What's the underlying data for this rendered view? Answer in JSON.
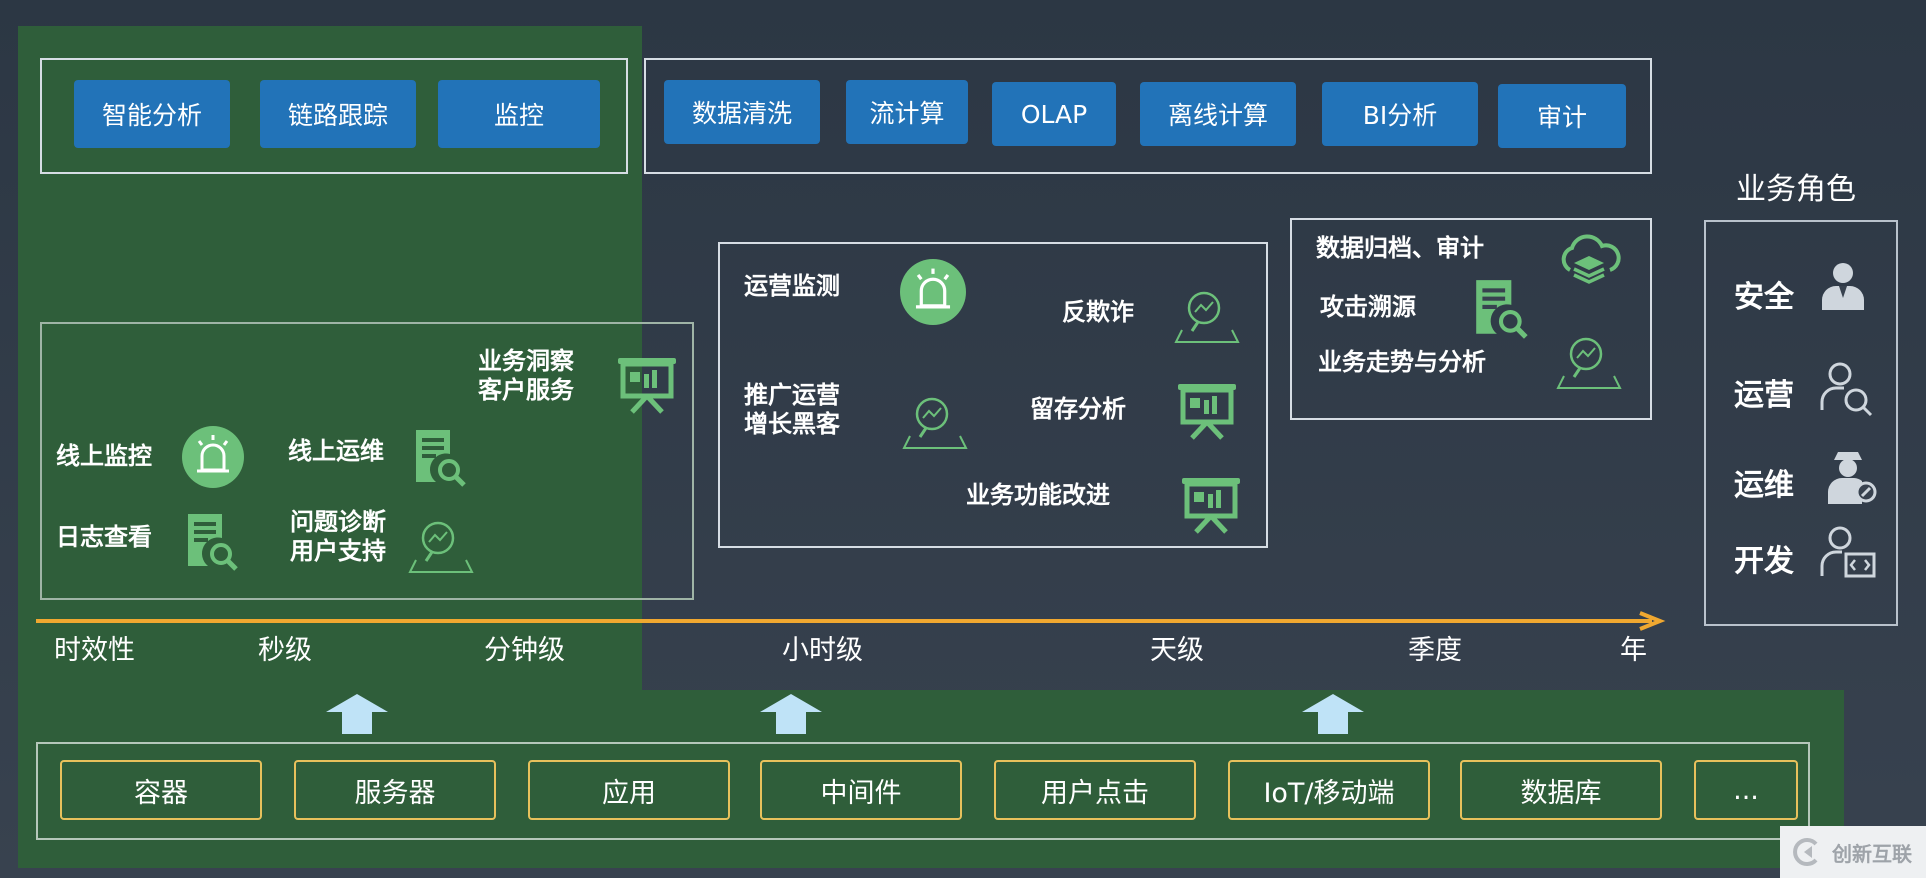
{
  "top_buttons_left": [
    "智能分析",
    "链路跟踪",
    "监控"
  ],
  "top_buttons_right": [
    "数据清洗",
    "流计算",
    "OLAP",
    "离线计算",
    "BI分析",
    "审计"
  ],
  "realtime_box": {
    "business_insight": [
      "业务洞察",
      "客户服务"
    ],
    "online_monitor": "线上监控",
    "online_ops": "线上运维",
    "log_view": "日志查看",
    "diagnosis": [
      "问题诊断",
      "用户支持"
    ]
  },
  "hourly_box": {
    "ops_monitor": "运营监测",
    "anti_fraud": "反欺诈",
    "promotion": [
      "推广运营",
      "增长黑客"
    ],
    "retention": "留存分析",
    "feature_improve": "业务功能改进"
  },
  "daily_box": {
    "archive_audit": "数据归档、审计",
    "attack_trace": "攻击溯源",
    "trend_analysis": "业务走势与分析"
  },
  "roles": {
    "title": "业务角色",
    "items": [
      "安全",
      "运营",
      "运维",
      "开发"
    ]
  },
  "timeline": {
    "ticks": [
      "时效性",
      "秒级",
      "分钟级",
      "小时级",
      "天级",
      "季度",
      "年"
    ]
  },
  "sources": [
    "容器",
    "服务器",
    "应用",
    "中间件",
    "用户点击",
    "IoT/移动端",
    "数据库",
    "..."
  ],
  "watermark": "创新互联",
  "colors": {
    "background": "#323d4a",
    "green_panel": "#2f5e3a",
    "blue_button": "#2273b8",
    "icon_green": "#6cc07a",
    "timeline_orange": "#f0a830",
    "source_border": "#e7c15c",
    "arrow_blue": "#bfe3f7"
  }
}
